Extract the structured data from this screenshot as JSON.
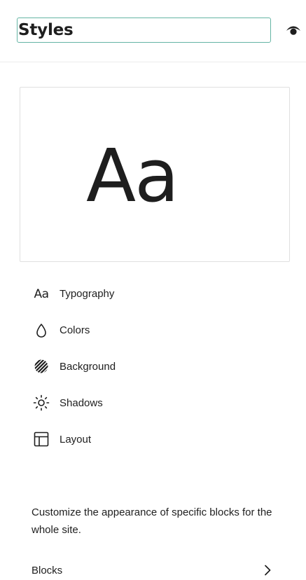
{
  "header": {
    "title": "Styles",
    "preview_icon": "eye-icon"
  },
  "preview": {
    "sample_text": "Aa"
  },
  "nav": {
    "items": [
      {
        "label": "Typography",
        "icon": "typography-icon",
        "glyph": "Aa"
      },
      {
        "label": "Colors",
        "icon": "droplet-icon"
      },
      {
        "label": "Background",
        "icon": "background-icon"
      },
      {
        "label": "Shadows",
        "icon": "sun-icon"
      },
      {
        "label": "Layout",
        "icon": "layout-icon"
      }
    ]
  },
  "blocks_section": {
    "description": "Customize the appearance of specific blocks for the whole site.",
    "label": "Blocks",
    "icon": "chevron-right-icon"
  }
}
